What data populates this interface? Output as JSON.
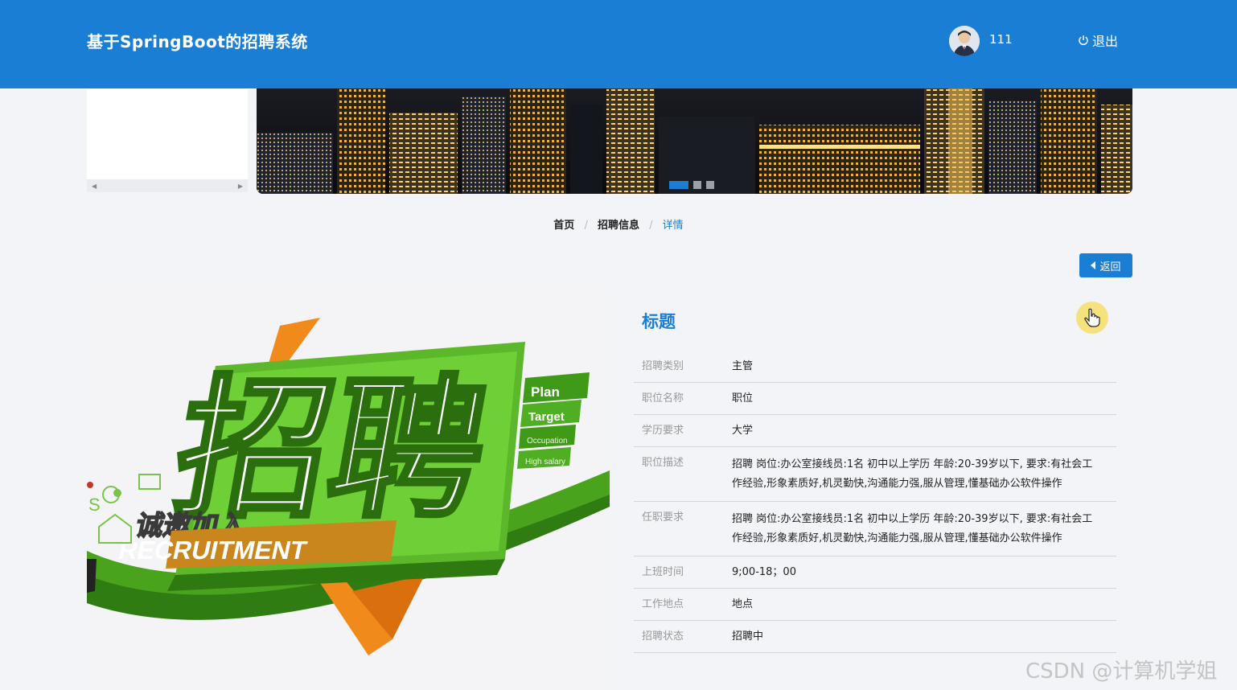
{
  "header": {
    "brand": "基于SpringBoot的招聘系统",
    "username": "111",
    "logout_label": "退出"
  },
  "banner": {
    "dots": 3,
    "active_dot": 0
  },
  "breadcrumb": {
    "home": "首页",
    "section": "招聘信息",
    "current": "详情",
    "separator": "/"
  },
  "back_button": {
    "label": "返回"
  },
  "poster": {
    "main_text": "招聘",
    "slogan": "诚邀加入",
    "english": "RECRUITMENT",
    "tags": [
      "Plan",
      "Target",
      "Occupation",
      "High salary"
    ]
  },
  "detail": {
    "title": "标题",
    "rows": [
      {
        "label": "招聘类别",
        "value": "主管"
      },
      {
        "label": "职位名称",
        "value": "职位"
      },
      {
        "label": "学历要求",
        "value": "大学"
      },
      {
        "label": "职位描述",
        "value": "招聘 岗位:办公室接线员:1名 初中以上学历 年龄:20-39岁以下, 要求:有社会工作经验,形象素质好,机灵勤快,沟通能力强,服从管理,懂基础办公软件操作"
      },
      {
        "label": "任职要求",
        "value": "招聘 岗位:办公室接线员:1名 初中以上学历 年龄:20-39岁以下, 要求:有社会工作经验,形象素质好,机灵勤快,沟通能力强,服从管理,懂基础办公软件操作"
      },
      {
        "label": "上班时间",
        "value": "9;00-18；00"
      },
      {
        "label": "工作地点",
        "value": "地点"
      },
      {
        "label": "招聘状态",
        "value": "招聘中"
      }
    ]
  },
  "watermark": "CSDN @计算机学姐",
  "colors": {
    "primary": "#1a7fd4",
    "background": "#f2f4f8",
    "row_border": "#c9d9ea",
    "label_gray": "#999999"
  }
}
